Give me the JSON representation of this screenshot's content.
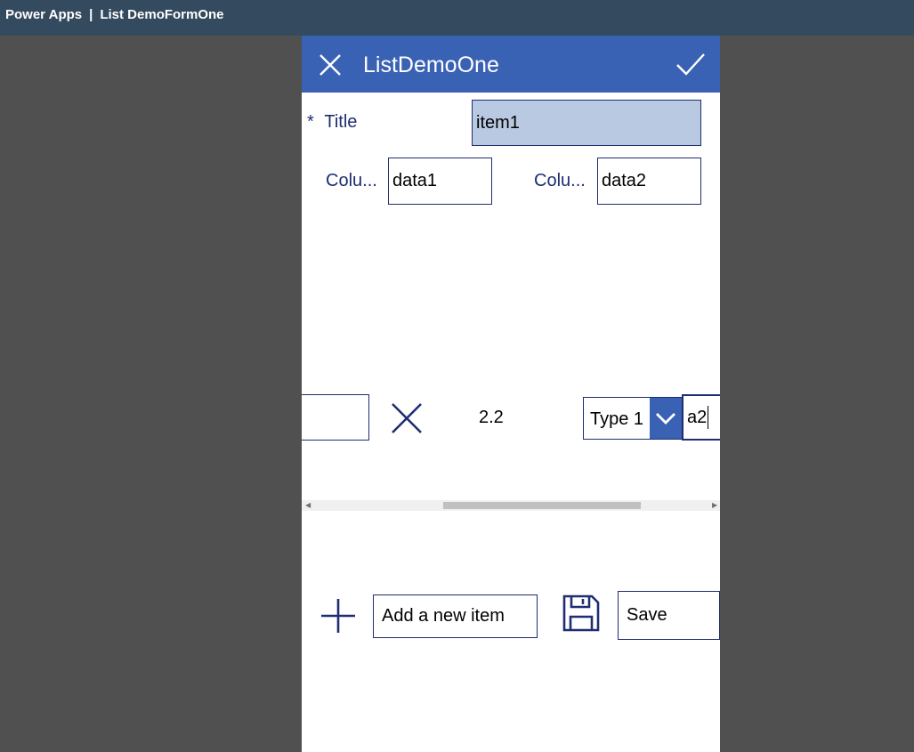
{
  "window": {
    "app_name": "Power Apps",
    "separator": "|",
    "document_name": "List DemoFormOne"
  },
  "header": {
    "title": "ListDemoOne",
    "close_icon": "close-icon",
    "check_icon": "checkmark-icon"
  },
  "form": {
    "title_required_mark": "*",
    "title_label": "Title",
    "title_value": "item1",
    "column1_label": "Colu...",
    "column1_value": "data1",
    "column2_label": "Colu...",
    "column2_value": "data2"
  },
  "gallery_row": {
    "first_input_value": "",
    "delete_icon": "close-icon",
    "number_value": "2.2",
    "type_dropdown_value": "Type 1",
    "last_input_value": "a2"
  },
  "scrollbar": {
    "position_fraction": 0.34,
    "thumb_fraction": 0.48
  },
  "actions": {
    "add_icon": "plus-icon",
    "add_label": "Add a new item",
    "save_icon": "save-icon",
    "save_label": "Save"
  },
  "colors": {
    "top_bar": "#344a5e",
    "header": "#3a62b4",
    "accent_text": "#1f2d72",
    "canvas": "#505050",
    "selected_field": "#b9c9e2"
  }
}
